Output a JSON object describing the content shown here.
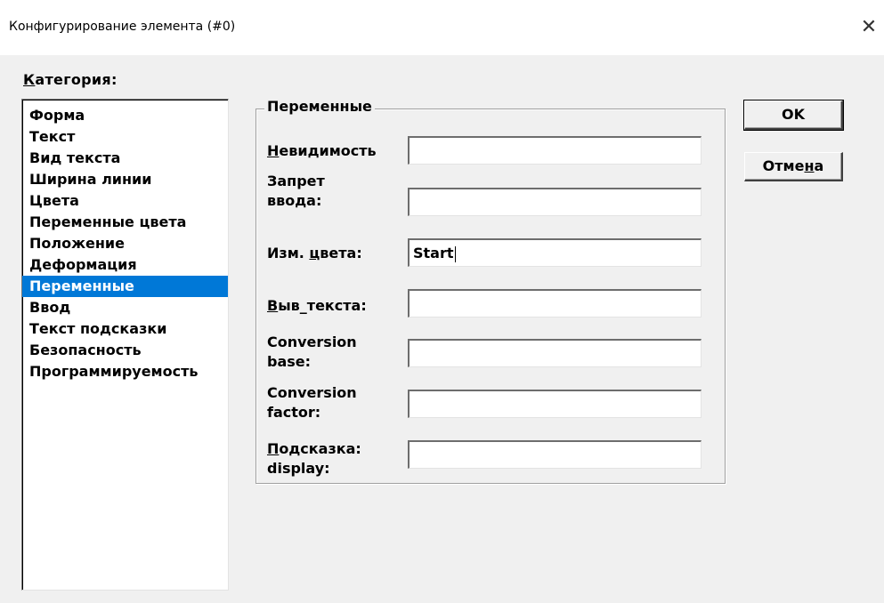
{
  "window": {
    "title": "Конфигурирование элемента (#0)",
    "close_glyph": "✕"
  },
  "category": {
    "label": "Категория:",
    "items": [
      {
        "label": "Форма"
      },
      {
        "label": "Текст"
      },
      {
        "label": "Вид текста"
      },
      {
        "label": "Ширина линии"
      },
      {
        "label": "Цвета"
      },
      {
        "label": "Переменные цвета"
      },
      {
        "label": "Положение"
      },
      {
        "label": "Деформация"
      },
      {
        "label": "Переменные",
        "selected": true
      },
      {
        "label": "Ввод"
      },
      {
        "label": "Текст подсказки"
      },
      {
        "label": "Безопасность"
      },
      {
        "label": "Программируемость"
      }
    ]
  },
  "group": {
    "title": "Переменные",
    "fields": [
      {
        "label": "Невидимость",
        "value": ""
      },
      {
        "label": "Запрет ввода:",
        "value": ""
      },
      {
        "label": "Изм. цвета:",
        "value": "Start"
      },
      {
        "label": "Выв_текста:",
        "value": ""
      },
      {
        "label": "Conversion base:",
        "value": ""
      },
      {
        "label": "Conversion factor:",
        "value": ""
      },
      {
        "label": "Подсказка: display:",
        "value": ""
      }
    ]
  },
  "buttons": {
    "ok_label": "OK",
    "cancel_label": "Отмена"
  },
  "colors": {
    "selection": "#0078d7",
    "dialog_bg": "#f0f0f0"
  }
}
